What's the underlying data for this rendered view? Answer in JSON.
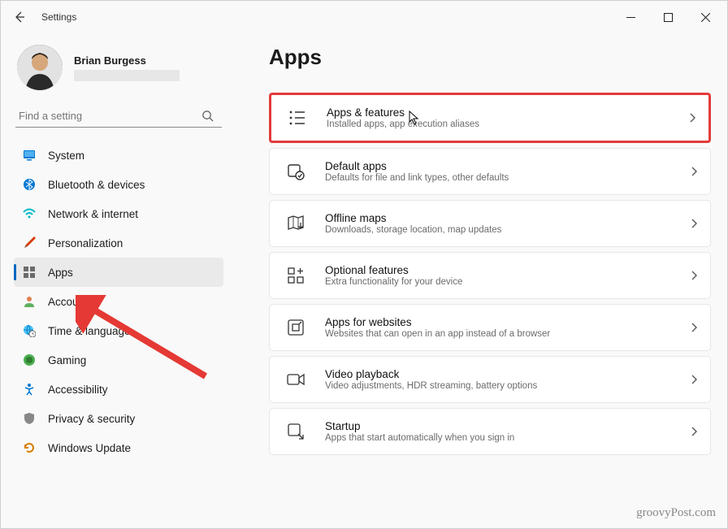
{
  "window": {
    "title": "Settings"
  },
  "profile": {
    "name": "Brian Burgess"
  },
  "search": {
    "placeholder": "Find a setting"
  },
  "sidebar": {
    "items": [
      {
        "label": "System"
      },
      {
        "label": "Bluetooth & devices"
      },
      {
        "label": "Network & internet"
      },
      {
        "label": "Personalization"
      },
      {
        "label": "Apps"
      },
      {
        "label": "Accounts"
      },
      {
        "label": "Time & language"
      },
      {
        "label": "Gaming"
      },
      {
        "label": "Accessibility"
      },
      {
        "label": "Privacy & security"
      },
      {
        "label": "Windows Update"
      }
    ]
  },
  "page": {
    "title": "Apps"
  },
  "cards": [
    {
      "title": "Apps & features",
      "desc": "Installed apps, app execution aliases"
    },
    {
      "title": "Default apps",
      "desc": "Defaults for file and link types, other defaults"
    },
    {
      "title": "Offline maps",
      "desc": "Downloads, storage location, map updates"
    },
    {
      "title": "Optional features",
      "desc": "Extra functionality for your device"
    },
    {
      "title": "Apps for websites",
      "desc": "Websites that can open in an app instead of a browser"
    },
    {
      "title": "Video playback",
      "desc": "Video adjustments, HDR streaming, battery options"
    },
    {
      "title": "Startup",
      "desc": "Apps that start automatically when you sign in"
    }
  ],
  "watermark": "groovyPost.com"
}
